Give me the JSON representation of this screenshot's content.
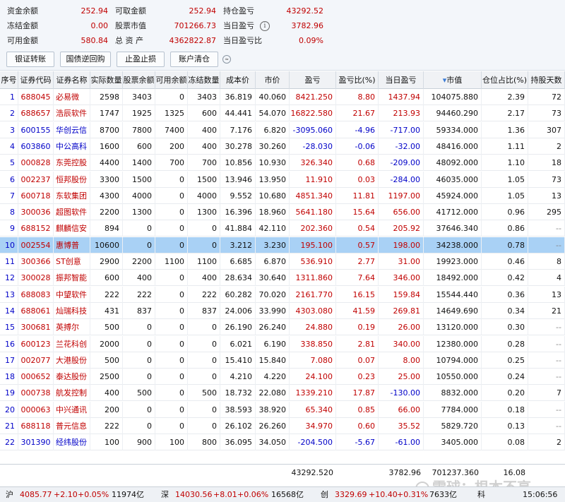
{
  "summary": {
    "row0": [
      {
        "label": "资金余额",
        "value": "252.94"
      },
      {
        "label": "可取金额",
        "value": "252.94"
      },
      {
        "label": "持仓盈亏",
        "value": "43292.52"
      }
    ],
    "row1": [
      {
        "label": "冻结金额",
        "value": "0.00"
      },
      {
        "label": "股票市值",
        "value": "701266.73"
      },
      {
        "label": "当日盈亏",
        "value": "3782.96"
      }
    ],
    "row2": [
      {
        "label": "可用金额",
        "value": "580.84"
      },
      {
        "label": "总 资 产",
        "value": "4362822.87"
      },
      {
        "label": "当日盈亏比",
        "value": "0.09%"
      }
    ],
    "info_icon": "i"
  },
  "toolbar": {
    "buttons": [
      "银证转账",
      "国债逆回购",
      "止盈止损",
      "账户清仓"
    ],
    "collapse_icon": "≈"
  },
  "table": {
    "headers": [
      "序号",
      "证券代码",
      "证券名称",
      "实际数量",
      "股票余额",
      "可用余额",
      "冻结数量",
      "成本价",
      "市价",
      "盈亏",
      "盈亏比(%)",
      "当日盈亏",
      "市值",
      "仓位占比(%)",
      "持股天数"
    ],
    "sort_indicator": "▾",
    "rows": [
      [
        "1",
        "688045",
        "必易微",
        "2598",
        "3403",
        "0",
        "3403",
        "36.819",
        "40.060",
        "8421.250",
        "8.80",
        "1437.94",
        "104075.880",
        "2.39",
        "72"
      ],
      [
        "2",
        "688657",
        "浩辰软件",
        "1747",
        "1925",
        "1325",
        "600",
        "44.441",
        "54.070",
        "16822.580",
        "21.67",
        "213.93",
        "94460.290",
        "2.17",
        "73"
      ],
      [
        "3",
        "600155",
        "华创云信",
        "8700",
        "7800",
        "7400",
        "400",
        "7.176",
        "6.820",
        "-3095.060",
        "-4.96",
        "-717.00",
        "59334.000",
        "1.36",
        "307"
      ],
      [
        "4",
        "603860",
        "中公高科",
        "1600",
        "600",
        "200",
        "400",
        "30.278",
        "30.260",
        "-28.030",
        "-0.06",
        "-32.00",
        "48416.000",
        "1.11",
        "2"
      ],
      [
        "5",
        "000828",
        "东莞控股",
        "4400",
        "1400",
        "700",
        "700",
        "10.856",
        "10.930",
        "326.340",
        "0.68",
        "-209.00",
        "48092.000",
        "1.10",
        "18"
      ],
      [
        "6",
        "002237",
        "恒邦股份",
        "3300",
        "1500",
        "0",
        "1500",
        "13.946",
        "13.950",
        "11.910",
        "0.03",
        "-284.00",
        "46035.000",
        "1.05",
        "73"
      ],
      [
        "7",
        "600718",
        "东软集团",
        "4300",
        "4000",
        "0",
        "4000",
        "9.552",
        "10.680",
        "4851.340",
        "11.81",
        "1197.00",
        "45924.000",
        "1.05",
        "13"
      ],
      [
        "8",
        "300036",
        "超图软件",
        "2200",
        "1300",
        "0",
        "1300",
        "16.396",
        "18.960",
        "5641.180",
        "15.64",
        "656.00",
        "41712.000",
        "0.96",
        "295"
      ],
      [
        "9",
        "688152",
        "麒麟信安",
        "894",
        "0",
        "0",
        "0",
        "41.884",
        "42.110",
        "202.360",
        "0.54",
        "205.92",
        "37646.340",
        "0.86",
        "--"
      ],
      [
        "10",
        "002554",
        "惠博普",
        "10600",
        "0",
        "0",
        "0",
        "3.212",
        "3.230",
        "195.100",
        "0.57",
        "198.00",
        "34238.000",
        "0.78",
        "--"
      ],
      [
        "11",
        "300366",
        "ST创意",
        "2900",
        "2200",
        "1100",
        "1100",
        "6.685",
        "6.870",
        "536.910",
        "2.77",
        "31.00",
        "19923.000",
        "0.46",
        "8"
      ],
      [
        "12",
        "300028",
        "振邦智能",
        "600",
        "400",
        "0",
        "400",
        "28.634",
        "30.640",
        "1311.860",
        "7.64",
        "346.00",
        "18492.000",
        "0.42",
        "4"
      ],
      [
        "13",
        "688083",
        "中望软件",
        "222",
        "222",
        "0",
        "222",
        "60.282",
        "70.020",
        "2161.770",
        "16.15",
        "159.84",
        "15544.440",
        "0.36",
        "13"
      ],
      [
        "14",
        "688061",
        "灿瑞科技",
        "431",
        "837",
        "0",
        "837",
        "24.006",
        "33.990",
        "4303.080",
        "41.59",
        "269.81",
        "14649.690",
        "0.34",
        "21"
      ],
      [
        "15",
        "300681",
        "英搏尔",
        "500",
        "0",
        "0",
        "0",
        "26.190",
        "26.240",
        "24.880",
        "0.19",
        "26.00",
        "13120.000",
        "0.30",
        "--"
      ],
      [
        "16",
        "600123",
        "兰花科创",
        "2000",
        "0",
        "0",
        "0",
        "6.021",
        "6.190",
        "338.850",
        "2.81",
        "340.00",
        "12380.000",
        "0.28",
        "--"
      ],
      [
        "17",
        "002077",
        "大港股份",
        "500",
        "0",
        "0",
        "0",
        "15.410",
        "15.840",
        "7.080",
        "0.07",
        "8.00",
        "10794.000",
        "0.25",
        "--"
      ],
      [
        "18",
        "000652",
        "泰达股份",
        "2500",
        "0",
        "0",
        "0",
        "4.210",
        "4.220",
        "24.100",
        "0.23",
        "25.00",
        "10550.000",
        "0.24",
        "--"
      ],
      [
        "19",
        "000738",
        "航发控制",
        "400",
        "500",
        "0",
        "500",
        "18.732",
        "22.080",
        "1339.210",
        "17.87",
        "-130.00",
        "8832.000",
        "0.20",
        "7"
      ],
      [
        "20",
        "000063",
        "中兴通讯",
        "200",
        "0",
        "0",
        "0",
        "38.593",
        "38.920",
        "65.340",
        "0.85",
        "66.00",
        "7784.000",
        "0.18",
        "--"
      ],
      [
        "21",
        "688118",
        "普元信息",
        "222",
        "0",
        "0",
        "0",
        "26.102",
        "26.260",
        "34.970",
        "0.60",
        "35.52",
        "5829.720",
        "0.13",
        "--"
      ],
      [
        "22",
        "301390",
        "经纬股份",
        "100",
        "900",
        "100",
        "800",
        "36.095",
        "34.050",
        "-204.500",
        "-5.67",
        "-61.00",
        "3405.000",
        "0.08",
        "2"
      ]
    ],
    "totals": {
      "pnl": "43292.520",
      "today_pnl": "3782.96",
      "market_value": "701237.360",
      "position_pct": "16.08"
    }
  },
  "statusbar": {
    "sh_label": "沪",
    "sh_index": "4085.77",
    "sh_change": "+2.10",
    "sh_pct": "+0.05%",
    "sh_amount": "11974亿",
    "sz_label": "深",
    "sz_index": "14030.56",
    "sz_change": "+8.01",
    "sz_pct": "+0.06%",
    "sz_amount": "16568亿",
    "cy_label": "创",
    "cy_index": "3329.69",
    "cy_change": "+10.40",
    "cy_pct": "+0.31%",
    "cy_amount": "7633亿",
    "kc_label": "科",
    "time": "15:06:56"
  },
  "watermark": "雪球：根本不亮"
}
